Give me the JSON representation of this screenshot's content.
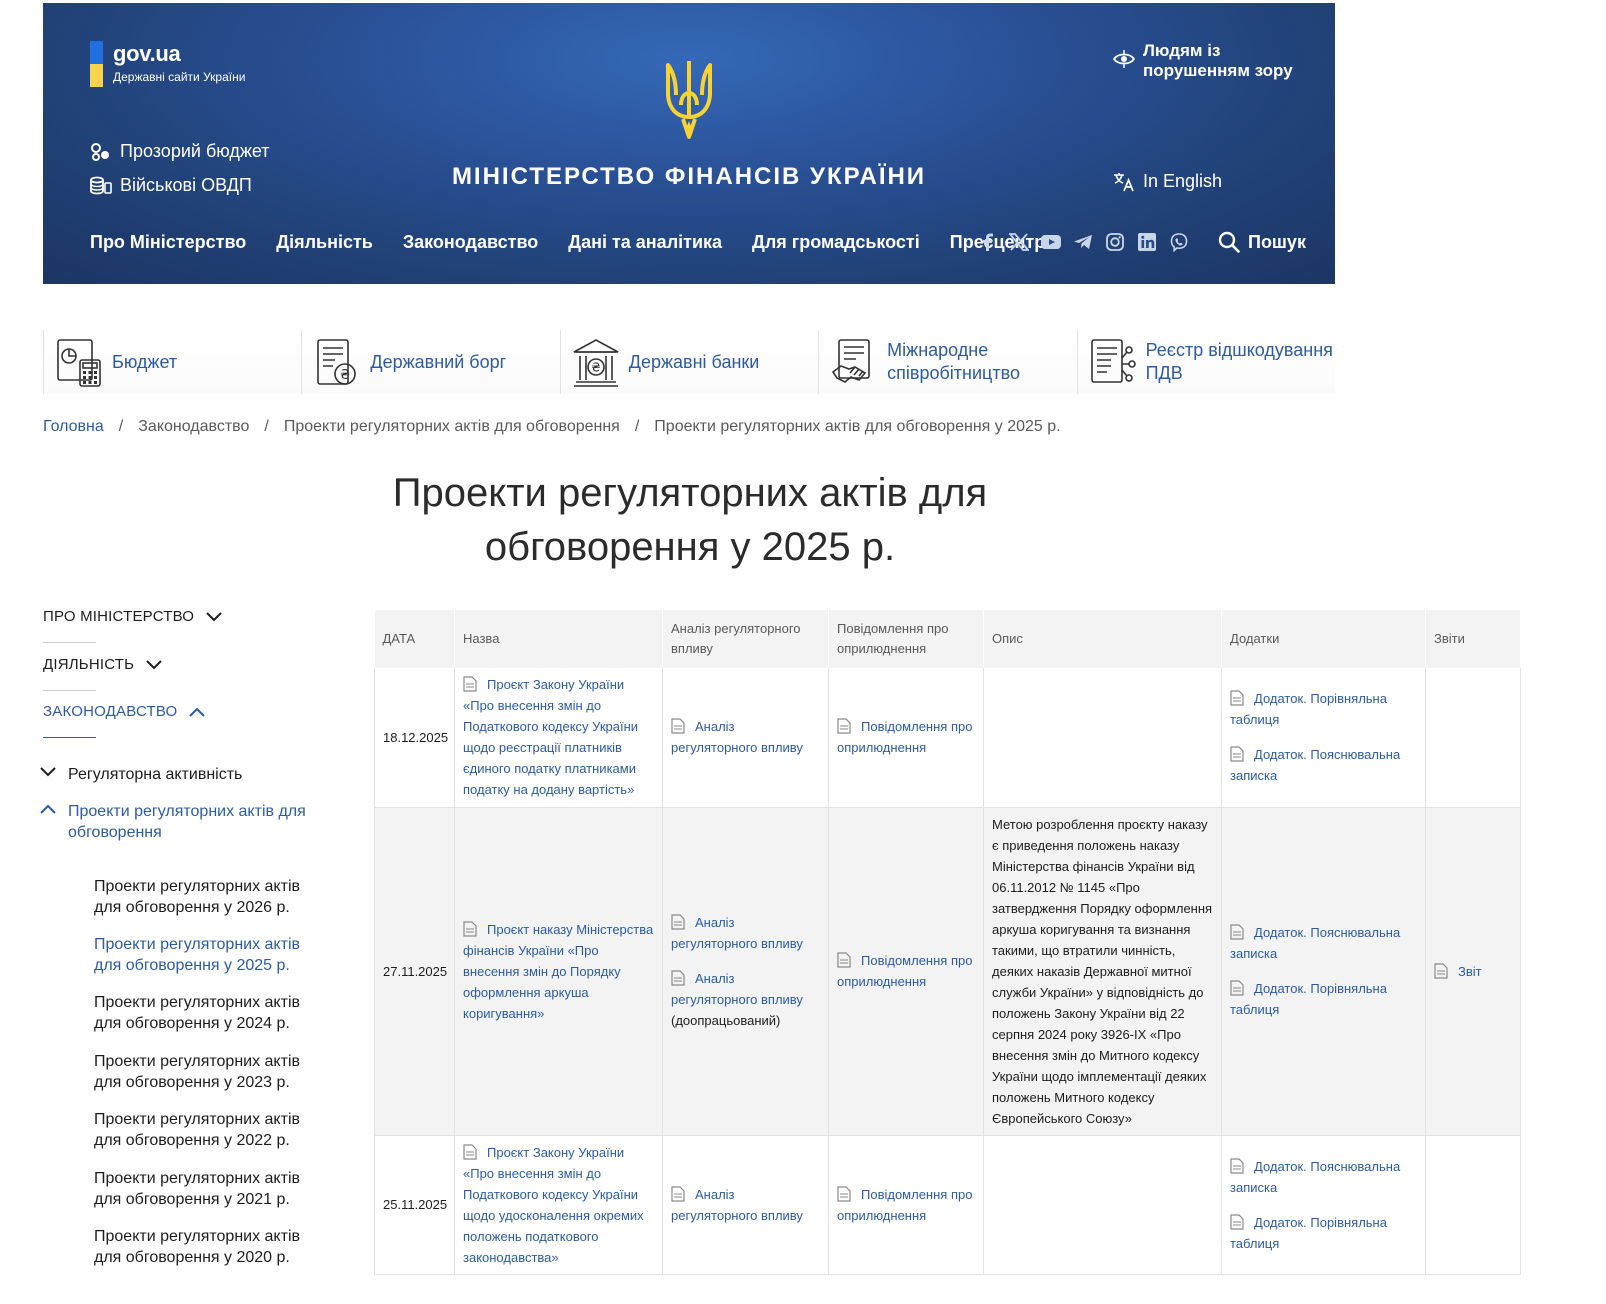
{
  "header": {
    "gov_title": "gov.ua",
    "gov_subtitle": "Державні сайти України",
    "budget_link": "Прозорий бюджет",
    "ovdp_link": "Військові ОВДП",
    "ministry_title": "МІНІСТЕРСТВО ФІНАНСІВ УКРАЇНИ",
    "vision_link": "Людям із порушенням зору",
    "english_link": "In English",
    "search_label": "Пошук",
    "nav": [
      "Про Міністерство",
      "Діяльність",
      "Законодавство",
      "Дані та аналітика",
      "Для громадськості",
      "Пресцентр"
    ],
    "socials": [
      "facebook-icon",
      "x-icon",
      "youtube-icon",
      "telegram-icon",
      "instagram-icon",
      "linkedin-icon",
      "viber-icon"
    ],
    "colors": {
      "flag_blue": "#1f6fe0",
      "flag_yellow": "#f8d24a",
      "header_blue": "#2a5298"
    }
  },
  "quick_links": [
    "Бюджет",
    "Державний борг",
    "Державні банки",
    "Міжнародне співробітництво",
    "Реєстр відшкодування ПДВ"
  ],
  "breadcrumb": [
    "Головна",
    "Законодавство",
    "Проекти регуляторних актів для обговорення",
    "Проекти регуляторних актів для обговорення у 2025 р."
  ],
  "breadcrumb_sep": "/",
  "page_title": "Проекти регуляторних актів для обговорення у 2025 р.",
  "sidebar": {
    "sections": [
      "ПРО МІНІСТЕРСТВО",
      "ДІЯЛЬНІСТЬ",
      "ЗАКОНОДАВСТВО"
    ],
    "sub_items": [
      "Регуляторна активність",
      "Проекти регуляторних актів для обговорення"
    ],
    "years": [
      "Проекти регуляторних актів для обговорення у 2026 р.",
      "Проекти регуляторних актів для обговорення у 2025 р.",
      "Проекти регуляторних актів для обговорення у 2024 р.",
      "Проекти регуляторних актів для обговорення у 2023 р.",
      "Проекти регуляторних актів для обговорення у 2022 р.",
      "Проекти регуляторних актів для обговорення у 2021 р.",
      "Проекти регуляторних актів для обговорення у 2020 р."
    ]
  },
  "table": {
    "headers": [
      "ДАТА",
      "Назва",
      "Аналіз регуляторного впливу",
      "Повідомлення про оприлюднення",
      "Опис",
      "Додатки",
      "Звіти"
    ],
    "rows": [
      {
        "date": "18.12.2025",
        "name": "Проєкт Закону України «Про внесення змін до Податкового кодексу України щодо реєстрації платників єдиного податку платниками податку на додану вартість»",
        "analysis_1": "Аналіз регуляторного впливу",
        "notice": "Повідомлення про оприлюднення",
        "appendix_1": "Додаток. Порівняльна таблиця",
        "appendix_2": "Додаток. Пояснювальна записка"
      },
      {
        "date": "27.11.2025",
        "name": "Проєкт наказу Міністерства фінансів України «Про внесення змін до Порядку оформлення аркуша коригування»",
        "analysis_1": "Аналіз регуляторного впливу",
        "analysis_2": "Аналіз регуляторного впливу",
        "analysis_2_suffix": "(доопрацьований)",
        "notice": "Повідомлення про оприлюднення",
        "description": "Метою розроблення проєкту наказу є приведення положень наказу Міністерства фінансів України від 06.11.2012 № 1145 «Про затвердження Порядку оформлення аркуша коригування та визнання такими, що втратили чинність, деяких наказів Державної митної служби України» у відповідність до положень Закону України від 22 серпня 2024 року 3926-IX «Про внесення змін до Митного кодексу України щодо імплементації деяких положень Митного кодексу Європейського Союзу»",
        "appendix_1": "Додаток. Пояснювальна записка",
        "appendix_2": "Додаток. Порівняльна таблиця",
        "report": "Звіт"
      },
      {
        "date": "25.11.2025",
        "name": "Проєкт Закону України «Про внесення змін до Податкового кодексу України щодо удосконалення окремих положень податкового законодавства»",
        "analysis_1": "Аналіз регуляторного впливу",
        "notice": "Повідомлення про оприлюднення",
        "appendix_1": "Додаток. Пояснювальна записка",
        "appendix_2": "Додаток. Порівняльна таблиця"
      }
    ]
  }
}
